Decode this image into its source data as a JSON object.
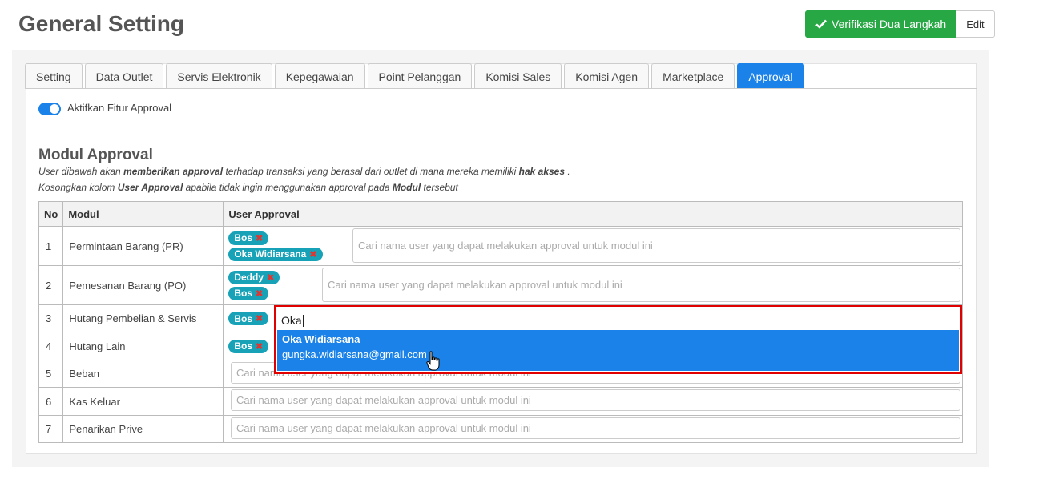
{
  "page": {
    "title": "General Setting"
  },
  "header": {
    "verify_label": "Verifikasi Dua Langkah",
    "edit_label": "Edit"
  },
  "tabs": [
    "Setting",
    "Data Outlet",
    "Servis Elektronik",
    "Kepegawaian",
    "Point Pelanggan",
    "Komisi Sales",
    "Komisi Agen",
    "Marketplace",
    "Approval"
  ],
  "active_tab": "Approval",
  "toggle": {
    "label": "Aktifkan Fitur Approval",
    "on": true
  },
  "section": {
    "title": "Modul Approval",
    "desc1_a": "User dibawah akan ",
    "desc1_b": "memberikan approval",
    "desc1_c": " terhadap transaksi yang berasal dari outlet di mana mereka memiliki ",
    "desc1_d": "hak akses",
    "desc1_e": " .",
    "desc2_a": "Kosongkan kolom ",
    "desc2_b": "User Approval",
    "desc2_c": " apabila tidak ingin menggunakan approval pada ",
    "desc2_d": "Modul",
    "desc2_e": " tersebut"
  },
  "table": {
    "headers": {
      "no": "No",
      "modul": "Modul",
      "user": "User Approval"
    },
    "placeholder": "Cari nama user yang dapat melakukan approval untuk modul ini",
    "rows": [
      {
        "no": "1",
        "modul": "Permintaan Barang (PR)",
        "tags": [
          "Bos",
          "Oka Widiarsana"
        ]
      },
      {
        "no": "2",
        "modul": "Pemesanan Barang (PO)",
        "tags": [
          "Deddy",
          "Bos"
        ]
      },
      {
        "no": "3",
        "modul": "Hutang Pembelian & Servis",
        "tags": [
          "Bos"
        ]
      },
      {
        "no": "4",
        "modul": "Hutang Lain",
        "tags": [
          "Bos"
        ]
      },
      {
        "no": "5",
        "modul": "Beban",
        "tags": []
      },
      {
        "no": "6",
        "modul": "Kas Keluar",
        "tags": []
      },
      {
        "no": "7",
        "modul": "Penarikan Prive",
        "tags": []
      }
    ]
  },
  "autocomplete": {
    "query": "Oka",
    "option_name": "Oka Widiarsana",
    "option_email": "gungka.widiarsana@gmail.com"
  },
  "colors": {
    "primary": "#1a82e8",
    "success": "#28a745",
    "tag": "#17a2b8",
    "highlight": "#e00000"
  }
}
